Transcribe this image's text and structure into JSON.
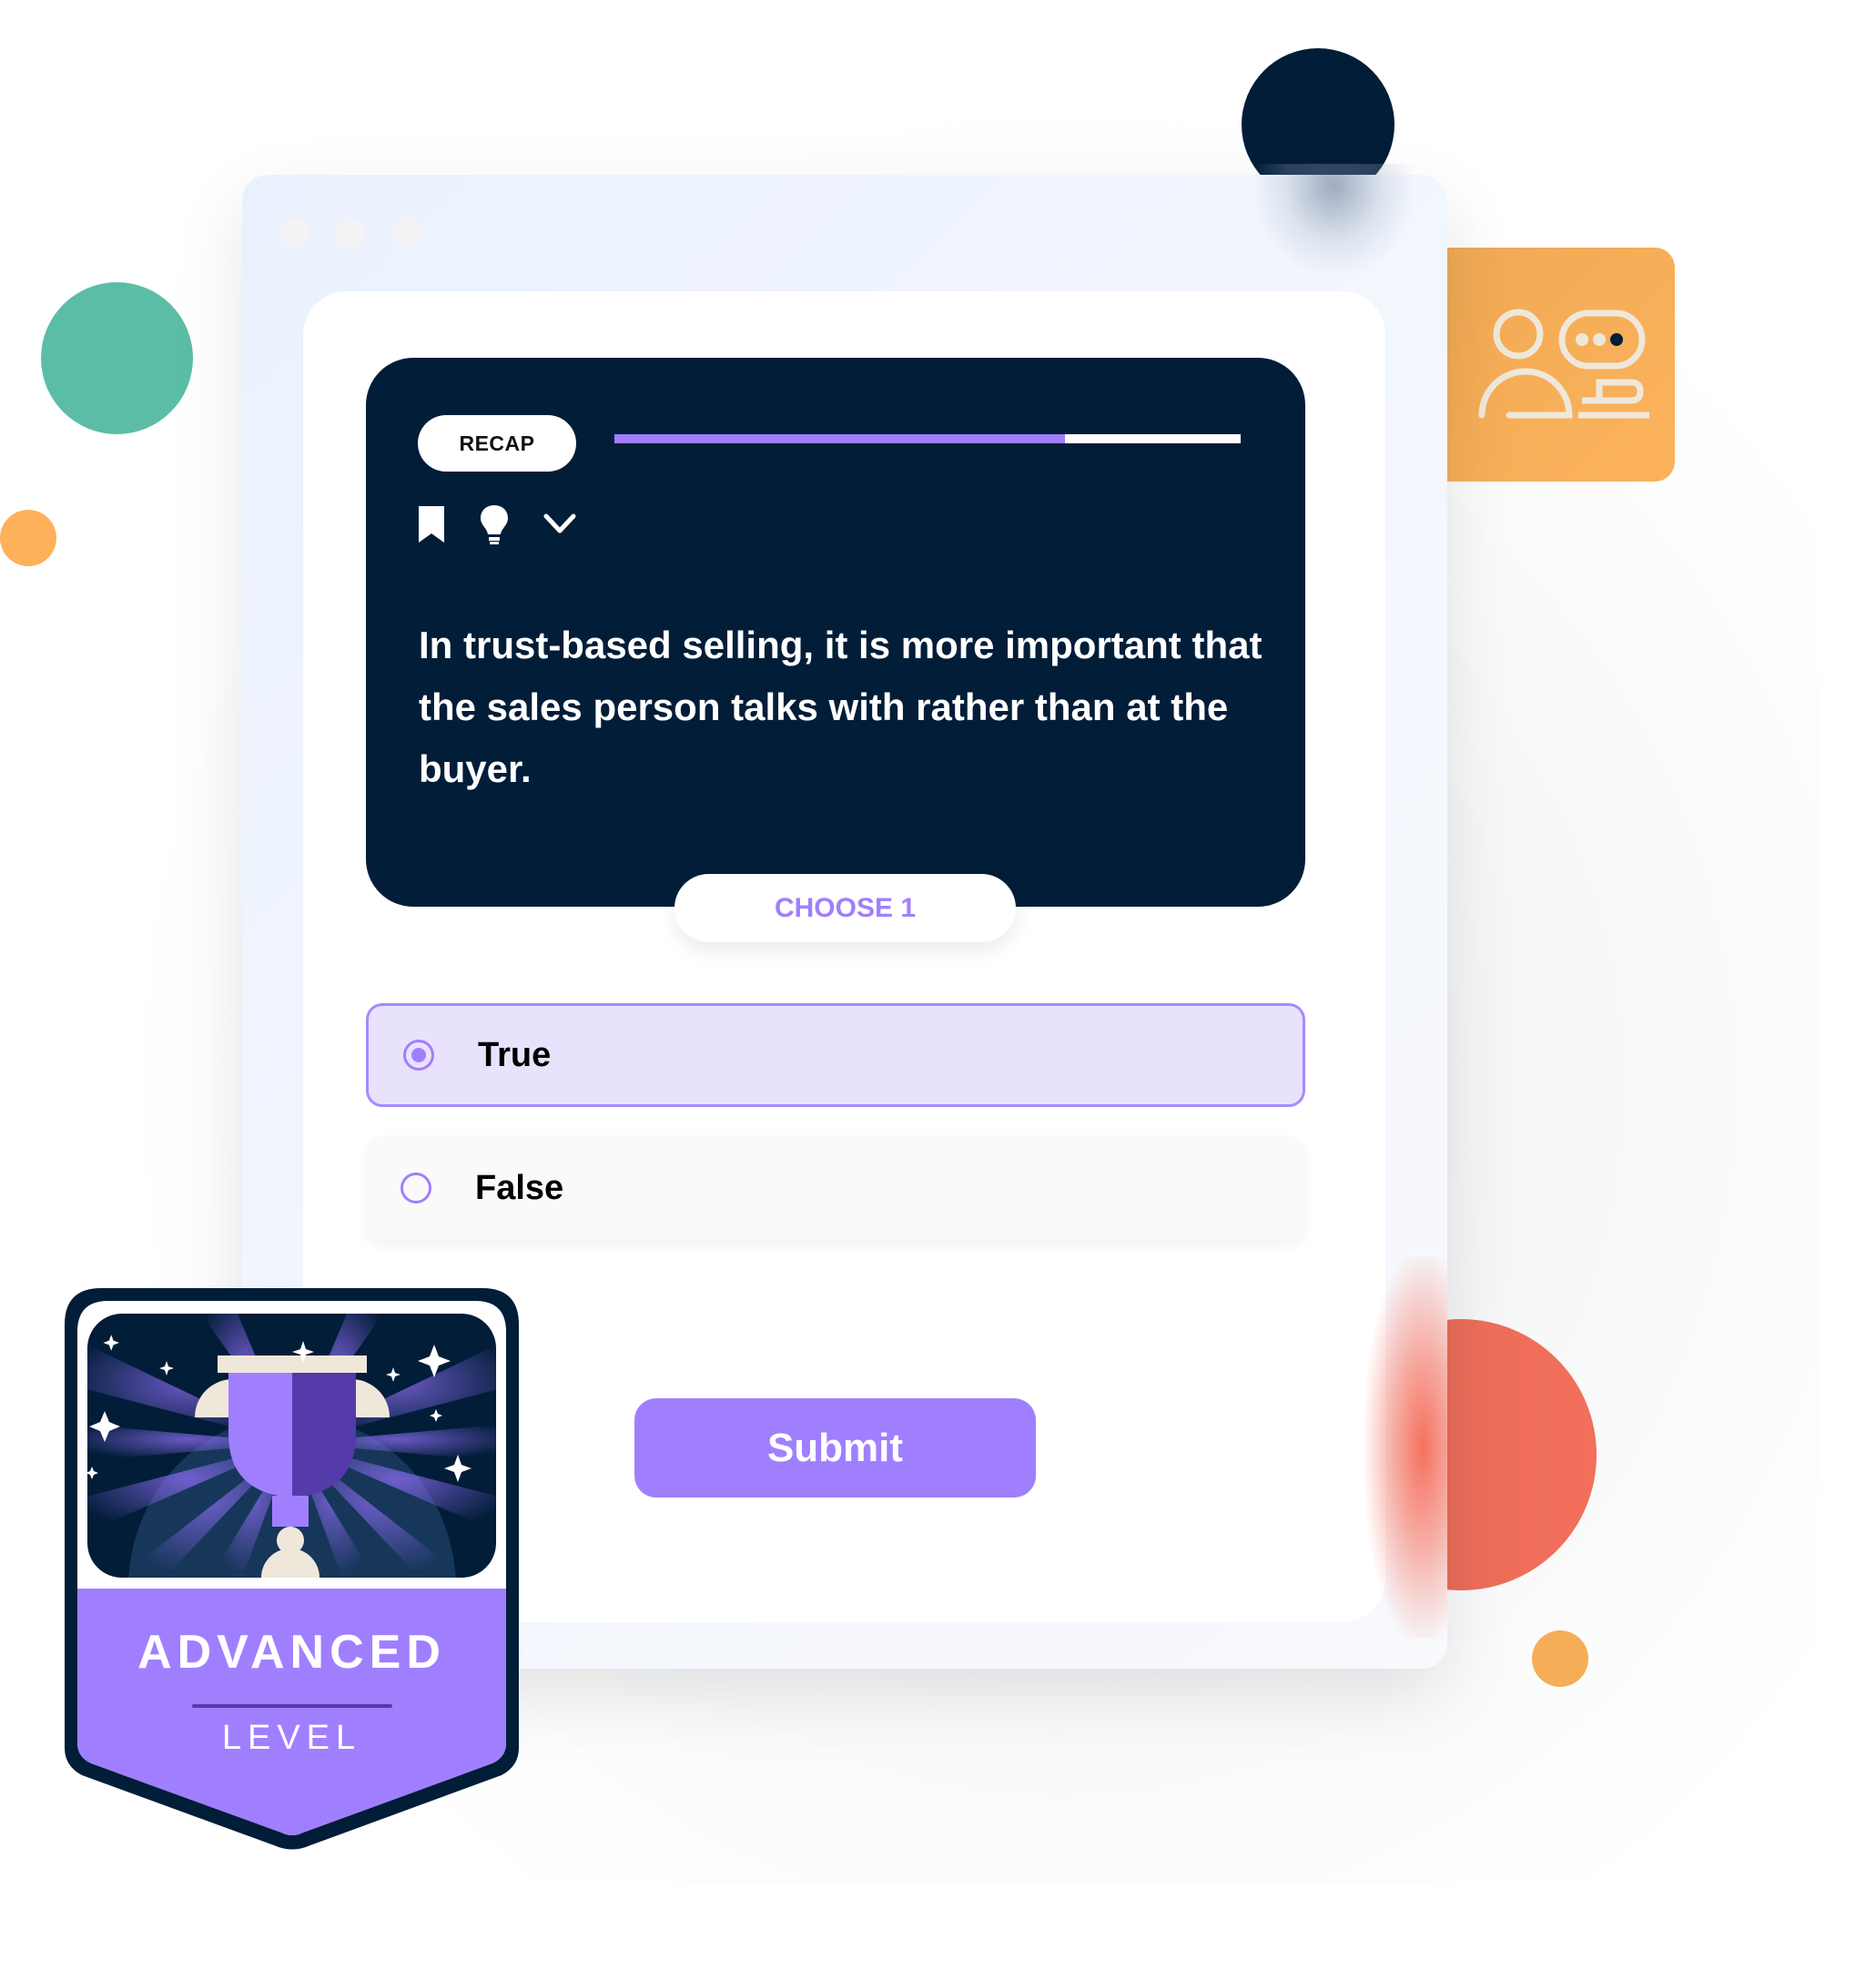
{
  "quiz": {
    "tag_label": "RECAP",
    "progress_percent": 72,
    "toolbar_icons": [
      "bookmark-icon",
      "lightbulb-icon",
      "chevron-down-icon"
    ],
    "question": "In trust-based selling, it is more important that the sales person talks with rather than at the buyer.",
    "instruction": "CHOOSE 1",
    "options": [
      {
        "label": "True",
        "selected": true
      },
      {
        "label": "False",
        "selected": false
      }
    ],
    "submit_label": "Submit"
  },
  "badge": {
    "title": "ADVANCED",
    "subtitle": "LEVEL",
    "icon": "trophy-icon"
  },
  "side_card": {
    "icon": "person-chat-icon"
  },
  "colors": {
    "accent": "#a07fff",
    "navy": "#021d38",
    "teal": "#5cbda6",
    "orange": "#fdb35c",
    "coral": "#f3705b",
    "selected_bg": "#e9e2fd"
  }
}
